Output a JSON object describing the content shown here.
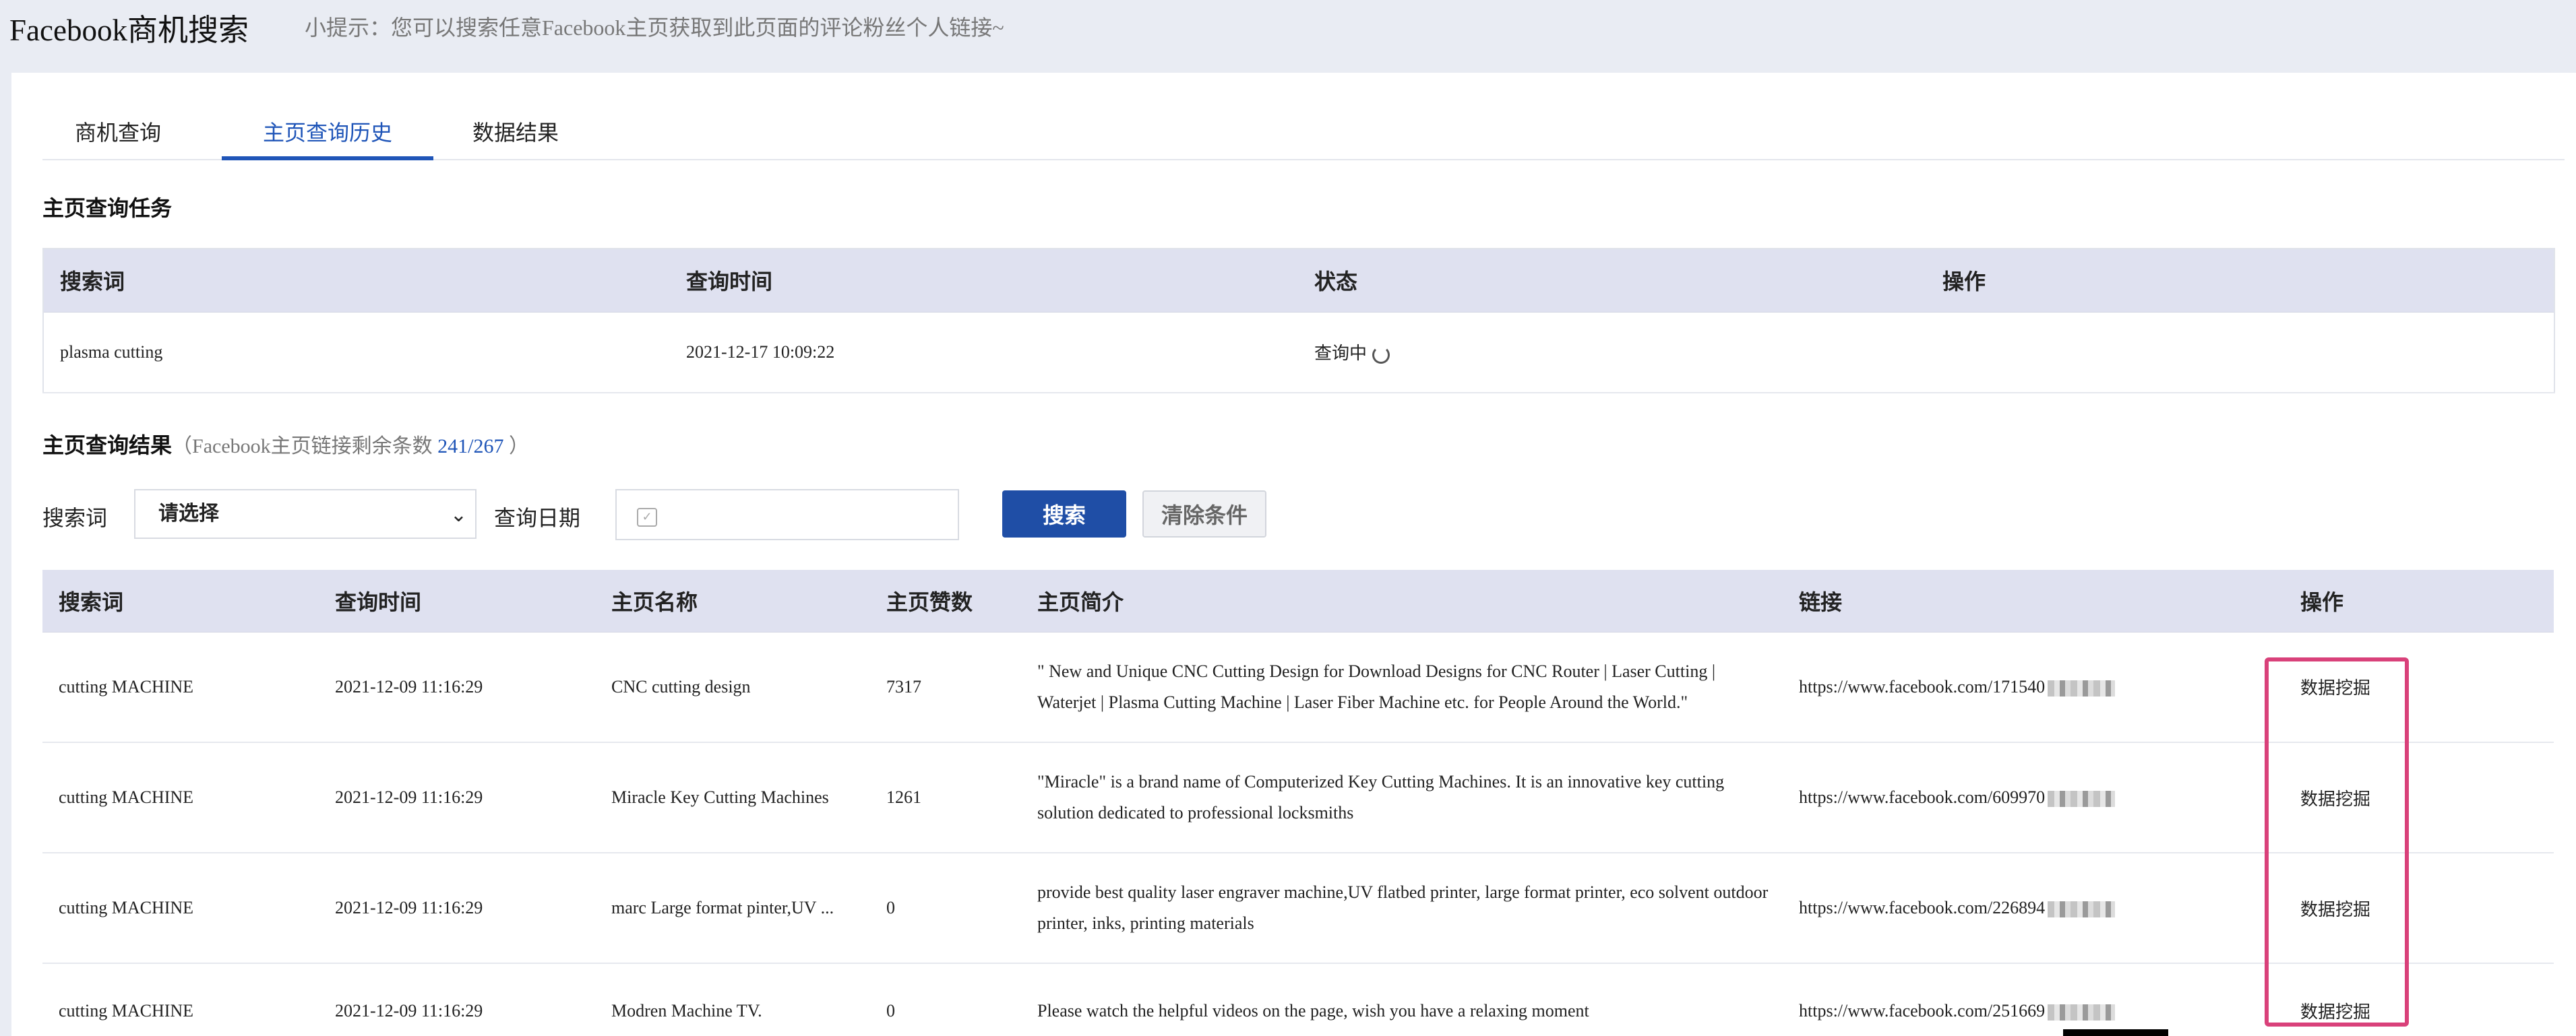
{
  "header": {
    "title": "Facebook商机搜索",
    "tip": "小提示：您可以搜索任意Facebook主页获取到此页面的评论粉丝个人链接~"
  },
  "tabs": [
    {
      "label": "商机查询",
      "active": false
    },
    {
      "label": "主页查询历史",
      "active": true
    },
    {
      "label": "数据结果",
      "active": false
    }
  ],
  "task_section": {
    "title": "主页查询任务",
    "columns": [
      "搜索词",
      "查询时间",
      "状态",
      "操作"
    ],
    "rows": [
      {
        "keyword": "plasma cutting",
        "time": "2021-12-17 10:09:22",
        "status": "查询中",
        "action": ""
      }
    ]
  },
  "result_section": {
    "title": "主页查询结果",
    "sub_prefix": "（Facebook主页链接剩余条数 ",
    "remaining": "241/267",
    "sub_suffix": " ）"
  },
  "filter": {
    "keyword_label": "搜索词",
    "keyword_value": "请选择",
    "date_label": "查询日期",
    "search_button": "搜索",
    "clear_button": "清除条件"
  },
  "results": {
    "columns": [
      "搜索词",
      "查询时间",
      "主页名称",
      "主页赞数",
      "主页简介",
      "链接",
      "操作"
    ],
    "rows": [
      {
        "keyword": "cutting MACHINE",
        "time": "2021-12-09 11:16:29",
        "name": "CNC cutting design",
        "likes": "7317",
        "desc": "\" New and Unique CNC Cutting Design for Download Designs for CNC Router | Laser Cutting | Waterjet | Plasma Cutting Machine | Laser Fiber Machine etc. for People Around the World.\"",
        "link": "https://www.facebook.com/171540",
        "action": "数据挖掘"
      },
      {
        "keyword": "cutting MACHINE",
        "time": "2021-12-09 11:16:29",
        "name": "Miracle Key Cutting Machines",
        "likes": "1261",
        "desc": "\"Miracle\" is a brand name of Computerized Key Cutting Machines. It is an innovative key cutting solution dedicated to professional locksmiths",
        "link": "https://www.facebook.com/609970",
        "action": "数据挖掘"
      },
      {
        "keyword": "cutting MACHINE",
        "time": "2021-12-09 11:16:29",
        "name": "marc Large format pinter,UV ...",
        "likes": "0",
        "desc": "provide best quality laser engraver machine,UV flatbed printer, large format printer, eco solvent outdoor printer, inks, printing materials",
        "link": "https://www.facebook.com/226894",
        "action": "数据挖掘"
      },
      {
        "keyword": "cutting MACHINE",
        "time": "2021-12-09 11:16:29",
        "name": "Modren Machine TV.",
        "likes": "0",
        "desc": "Please watch the helpful videos on the page, wish you have a relaxing moment",
        "link": "https://www.facebook.com/251669",
        "action": "数据挖掘"
      }
    ]
  },
  "colors": {
    "accent": "#1f55b8",
    "header_bg": "#dfe1f0",
    "highlight": "#d9417a"
  }
}
